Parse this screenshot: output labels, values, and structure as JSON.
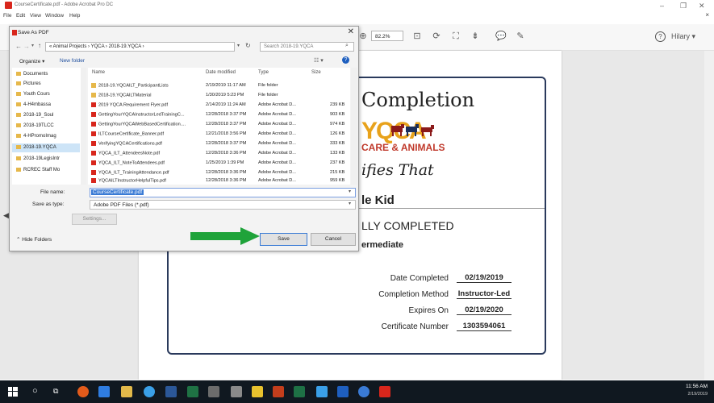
{
  "window": {
    "title": "CourseCertificate.pdf - Adobe Acrobat Pro DC",
    "menu": [
      "File",
      "Edit",
      "View",
      "Window",
      "Help"
    ],
    "minimize": "–",
    "restore": "❐",
    "close": "✕",
    "close_doc": "×"
  },
  "toolbar": {
    "zoom": "82.2%",
    "user": "Hilary"
  },
  "certificate": {
    "title_fragment": "Completion",
    "logo_letters": "YQCA",
    "logo_tagline": "CARE & ANIMALS",
    "certifies": "ifies That",
    "name_fragment": "le Kid",
    "completed_fragment": "LLY COMPLETED",
    "level_fragment": "ermediate",
    "rows": [
      {
        "label": "Date Completed",
        "value": "02/19/2019"
      },
      {
        "label": "Completion Method",
        "value": "Instructor-Led"
      },
      {
        "label": "Expires On",
        "value": "02/19/2020"
      },
      {
        "label": "Certificate Number",
        "value": "1303594061"
      }
    ]
  },
  "dialog": {
    "title": "Save As PDF",
    "address": "« Animal Projects › YQCA › 2018-19.YQCA ›",
    "search_placeholder": "Search 2018-19.YQCA",
    "organize": "Organize ▾",
    "new_folder": "New folder",
    "nav_items": [
      "Documents",
      "Pictures",
      "Youth Cours",
      "4-H4mbassa",
      "2018-19_Soul",
      "2018-19TLCC",
      "4-HPromoImag",
      "2018-19.YQCA",
      "2018-19LegisIntr",
      "RCREC Staff Mo"
    ],
    "columns": [
      "Name",
      "Date modified",
      "Type",
      "Size"
    ],
    "files": [
      {
        "name": "2018-19.YQCAILT_ParticipantLists",
        "date": "2/19/2019 11:17 AM",
        "type": "File folder",
        "size": "",
        "kind": "folder"
      },
      {
        "name": "2018-19.YQCAILTMaterial",
        "date": "1/30/2019 5:23 PM",
        "type": "File folder",
        "size": "",
        "kind": "folder"
      },
      {
        "name": "2019 YQCA Requirement Flyer.pdf",
        "date": "2/14/2019 11:24 AM",
        "type": "Adobe Acrobat D...",
        "size": "239 KB",
        "kind": "pdf"
      },
      {
        "name": "GettingYourYQCAInstructorLedTrainingC...",
        "date": "12/28/2018 3:37 PM",
        "type": "Adobe Acrobat D...",
        "size": "903 KB",
        "kind": "pdf"
      },
      {
        "name": "GettingYourYQCAWebBasedCertification....",
        "date": "12/28/2018 3:37 PM",
        "type": "Adobe Acrobat D...",
        "size": "974 KB",
        "kind": "pdf"
      },
      {
        "name": "ILTCourseCertificate_Banner.pdf",
        "date": "12/21/2018 3:56 PM",
        "type": "Adobe Acrobat D...",
        "size": "126 KB",
        "kind": "pdf"
      },
      {
        "name": "VerifyingYQCACertifications.pdf",
        "date": "12/28/2018 3:37 PM",
        "type": "Adobe Acrobat D...",
        "size": "333 KB",
        "kind": "pdf"
      },
      {
        "name": "YQCA_ILT_AttendeesNote.pdf",
        "date": "12/28/2018 3:36 PM",
        "type": "Adobe Acrobat D...",
        "size": "133 KB",
        "kind": "pdf"
      },
      {
        "name": "YQCA_ILT_NoteToAttendees.pdf",
        "date": "1/25/2019 1:39 PM",
        "type": "Adobe Acrobat D...",
        "size": "237 KB",
        "kind": "pdf"
      },
      {
        "name": "YQCA_ILT_TrainingAttendance.pdf",
        "date": "12/28/2018 3:36 PM",
        "type": "Adobe Acrobat D...",
        "size": "215 KB",
        "kind": "pdf"
      },
      {
        "name": "YQCAILTInstructorHelpfulTips.pdf",
        "date": "12/28/2018 3:36 PM",
        "type": "Adobe Acrobat D...",
        "size": "959 KB",
        "kind": "pdf"
      }
    ],
    "file_name_label": "File name:",
    "file_name_value": "CourseCertificate.pdf",
    "save_type_label": "Save as type:",
    "save_type_value": "Adobe PDF Files (*.pdf)",
    "settings": "Settings...",
    "hide_folders": "Hide Folders",
    "save": "Save",
    "cancel": "Cancel"
  },
  "taskbar": {
    "time": "11:56 AM",
    "date": "2/19/2019"
  },
  "colors": {
    "accent": "#3a7bd5",
    "arrow": "#1fa33a",
    "acrobat_red": "#d8261c",
    "cert_border": "#2a3a5c"
  }
}
